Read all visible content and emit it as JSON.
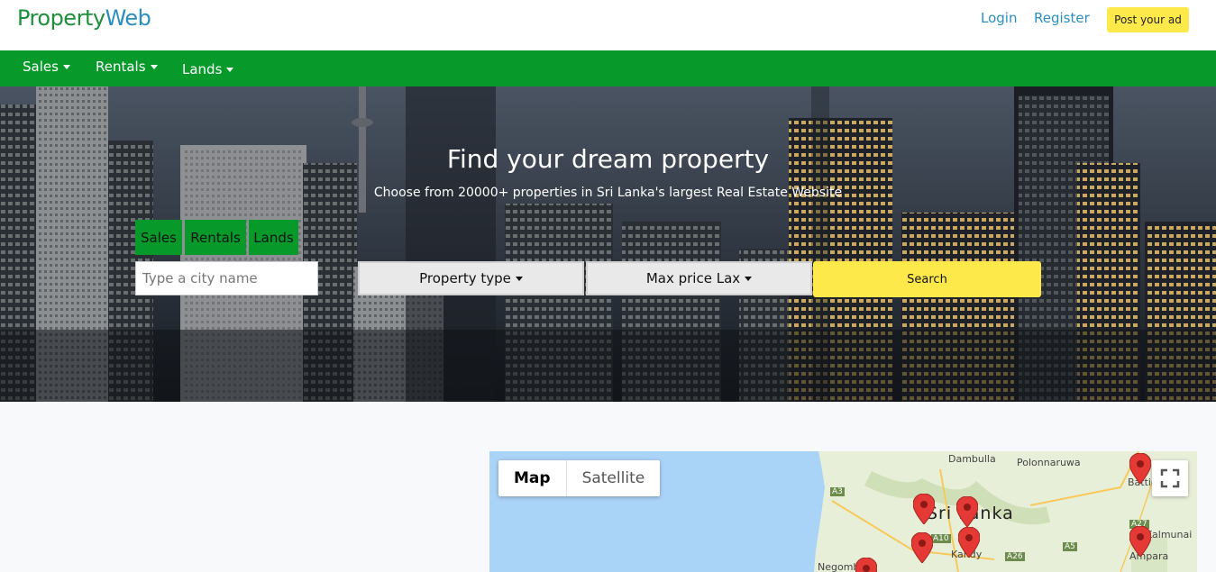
{
  "brand": {
    "part1": "Property",
    "part2": "Web"
  },
  "header": {
    "login": "Login",
    "register": "Register",
    "post_ad": "Post your ad"
  },
  "nav": {
    "items": [
      {
        "label": "Sales"
      },
      {
        "label": "Rentals"
      },
      {
        "label": "Lands"
      }
    ]
  },
  "hero": {
    "title": "Find your dream property",
    "subtitle": "Choose from 20000+ properties in Sri Lanka's largest Real Estate Website"
  },
  "search": {
    "tabs": [
      {
        "label": "Sales"
      },
      {
        "label": "Rentals"
      },
      {
        "label": "Lands"
      }
    ],
    "city_placeholder": "Type a city name",
    "property_type": "Property type",
    "max_price": "Max price Lax",
    "button": "Search"
  },
  "map": {
    "type_map": "Map",
    "type_satellite": "Satellite",
    "country_label": "Sri Lanka",
    "places": [
      "Dambulla",
      "Polonnaruwa",
      "Kandy",
      "Batticaloa",
      "Kalmunai",
      "Ampara",
      "Negombo"
    ],
    "roads": [
      "A3",
      "A10",
      "A26",
      "A5",
      "A27"
    ],
    "colors": {
      "land": "#e8efd9",
      "water": "#aad3f8",
      "pin": "#e53935",
      "road": "#f7c95c"
    }
  },
  "colors": {
    "nav_green": "#079a2a",
    "accent_yellow": "#fde94a",
    "link_blue": "#2a8fbf",
    "brand_green": "#1e8f3a"
  }
}
